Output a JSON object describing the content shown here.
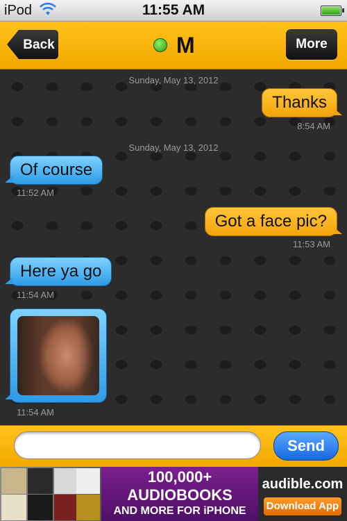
{
  "status_bar": {
    "carrier": "iPod",
    "time": "11:55 AM"
  },
  "nav": {
    "back_label": "Back",
    "title": "M",
    "more_label": "More",
    "online_color": "#4ccf2a"
  },
  "messages": [
    {
      "type": "date",
      "text": "Sunday, May 13, 2012"
    },
    {
      "type": "outgoing",
      "text": "Thanks",
      "time": "8:54 AM"
    },
    {
      "type": "date",
      "text": "Sunday, May 13, 2012"
    },
    {
      "type": "incoming",
      "text": "Of course",
      "time": "11:52 AM"
    },
    {
      "type": "outgoing",
      "text": "Got a face pic?",
      "time": "11:53 AM"
    },
    {
      "type": "incoming",
      "text": "Here ya go",
      "time": "11:54 AM"
    },
    {
      "type": "incoming-image",
      "time": "11:54 AM"
    }
  ],
  "composer": {
    "input_value": "",
    "send_label": "Send"
  },
  "ad": {
    "line1": "100,000+",
    "line2": "AUDIOBOOKS",
    "line3": "AND MORE FOR iPHONE",
    "brand": "audible.com",
    "cta": "Download App"
  },
  "colors": {
    "brand_orange": "#f2a800",
    "incoming_blue": "#2d9be6",
    "outgoing_orange": "#f3a40b",
    "send_blue": "#1768e0"
  }
}
